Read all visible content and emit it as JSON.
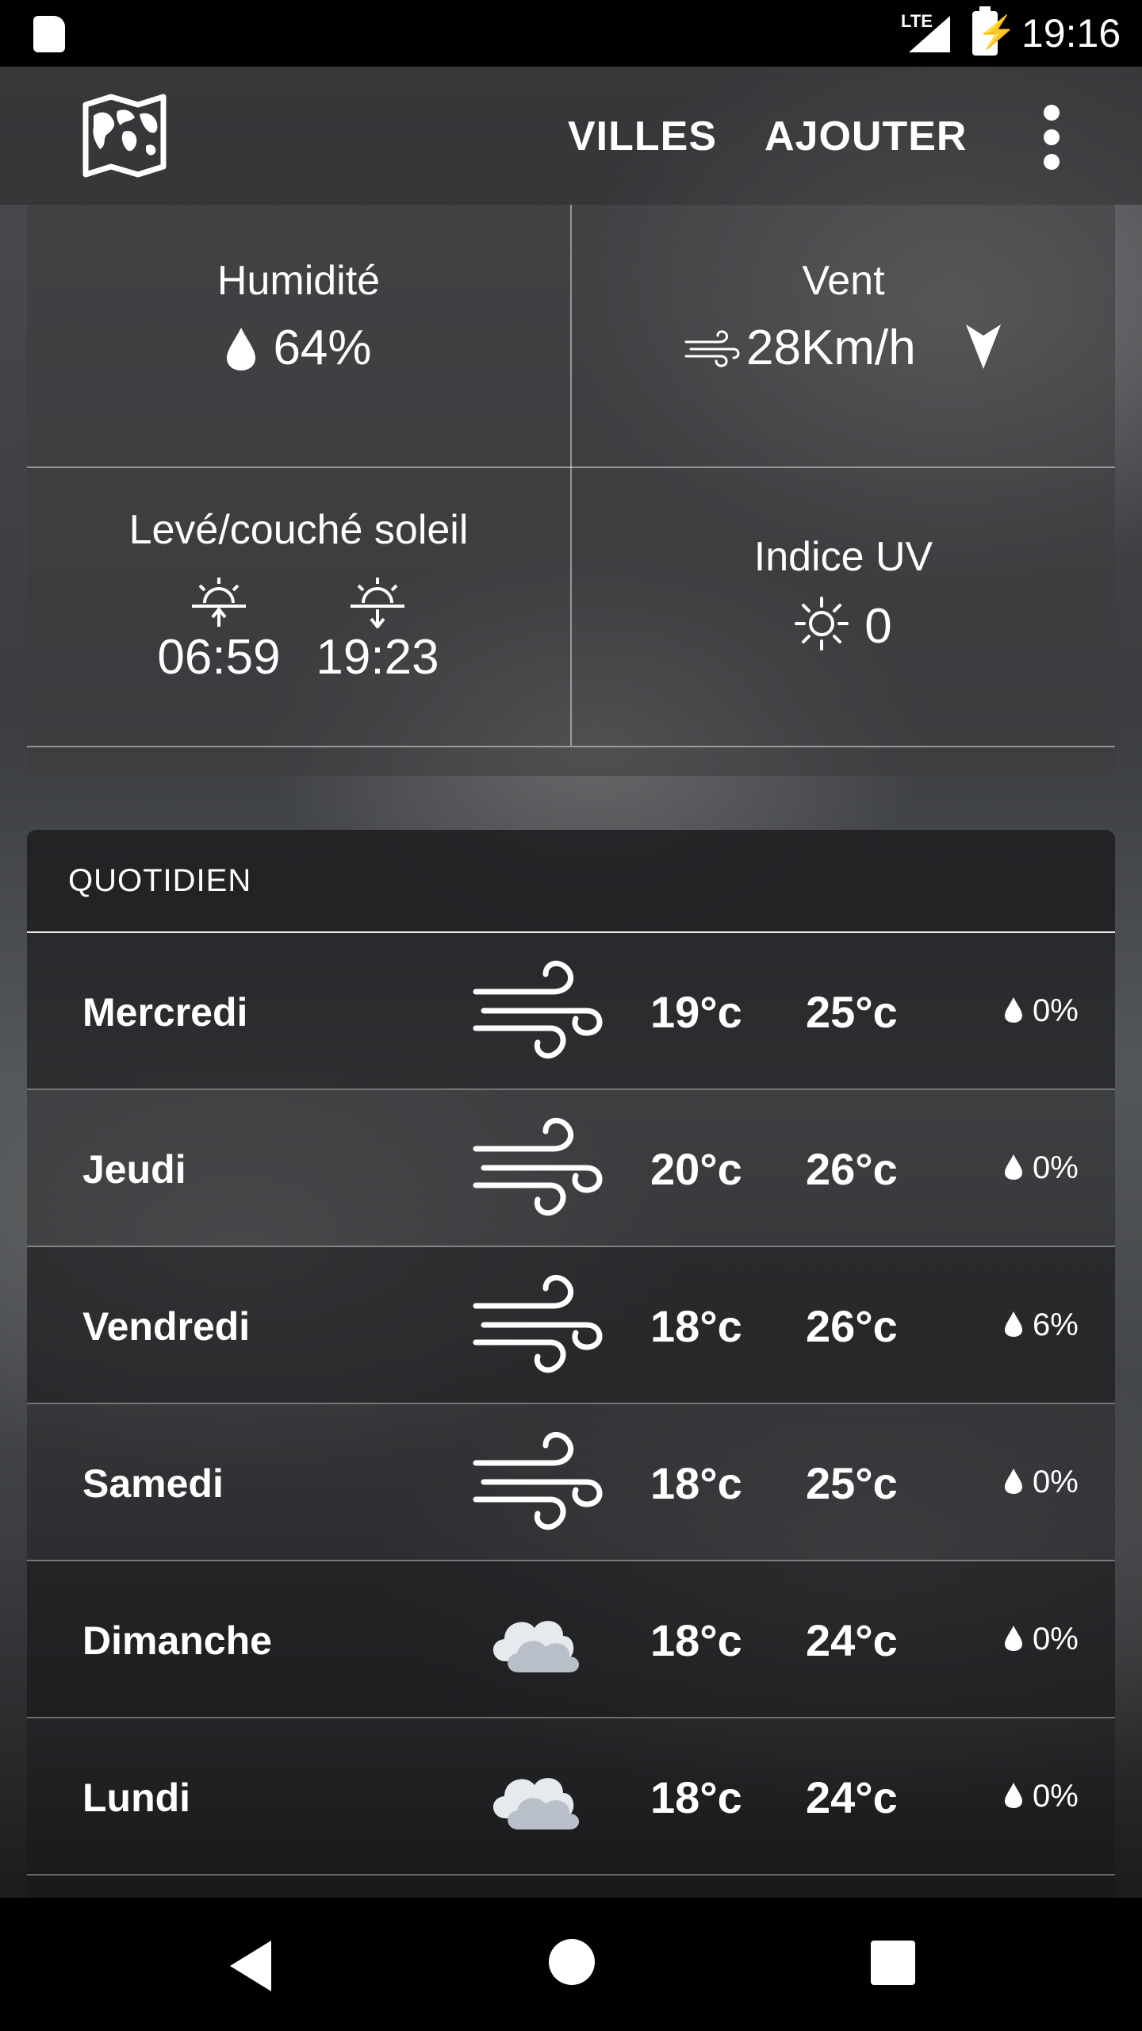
{
  "status_bar": {
    "network": "LTE",
    "time": "19:16"
  },
  "app_bar": {
    "logo_icon": "world-map-icon",
    "actions": {
      "cities": "VILLES",
      "add": "AJOUTER"
    },
    "more_icon": "more-vert-icon"
  },
  "details": {
    "humidity": {
      "title": "Humidité",
      "value": "64%",
      "icon": "water-drop-icon"
    },
    "wind": {
      "title": "Vent",
      "value": "28Km/h",
      "icon": "wind-icon",
      "direction_icon": "wind-direction-arrow-icon"
    },
    "sun": {
      "title": "Levé/couché soleil",
      "sunrise": "06:59",
      "sunset": "19:23"
    },
    "uv": {
      "title": "Indice UV",
      "value": "0",
      "icon": "sun-outline-icon"
    }
  },
  "daily": {
    "header": "QUOTIDIEN",
    "days": [
      {
        "name": "Mercredi",
        "icon": "windy-icon",
        "min": "19°c",
        "max": "25°c",
        "rain": "0%"
      },
      {
        "name": "Jeudi",
        "icon": "windy-icon",
        "min": "20°c",
        "max": "26°c",
        "rain": "0%"
      },
      {
        "name": "Vendredi",
        "icon": "windy-icon",
        "min": "18°c",
        "max": "26°c",
        "rain": "6%"
      },
      {
        "name": "Samedi",
        "icon": "windy-icon",
        "min": "18°c",
        "max": "25°c",
        "rain": "0%"
      },
      {
        "name": "Dimanche",
        "icon": "cloud-icon",
        "min": "18°c",
        "max": "24°c",
        "rain": "0%"
      },
      {
        "name": "Lundi",
        "icon": "cloud-icon",
        "min": "18°c",
        "max": "24°c",
        "rain": "0%"
      }
    ]
  },
  "nav_bar": {
    "back_icon": "back-icon",
    "home_icon": "home-icon",
    "recents_icon": "recents-icon"
  }
}
